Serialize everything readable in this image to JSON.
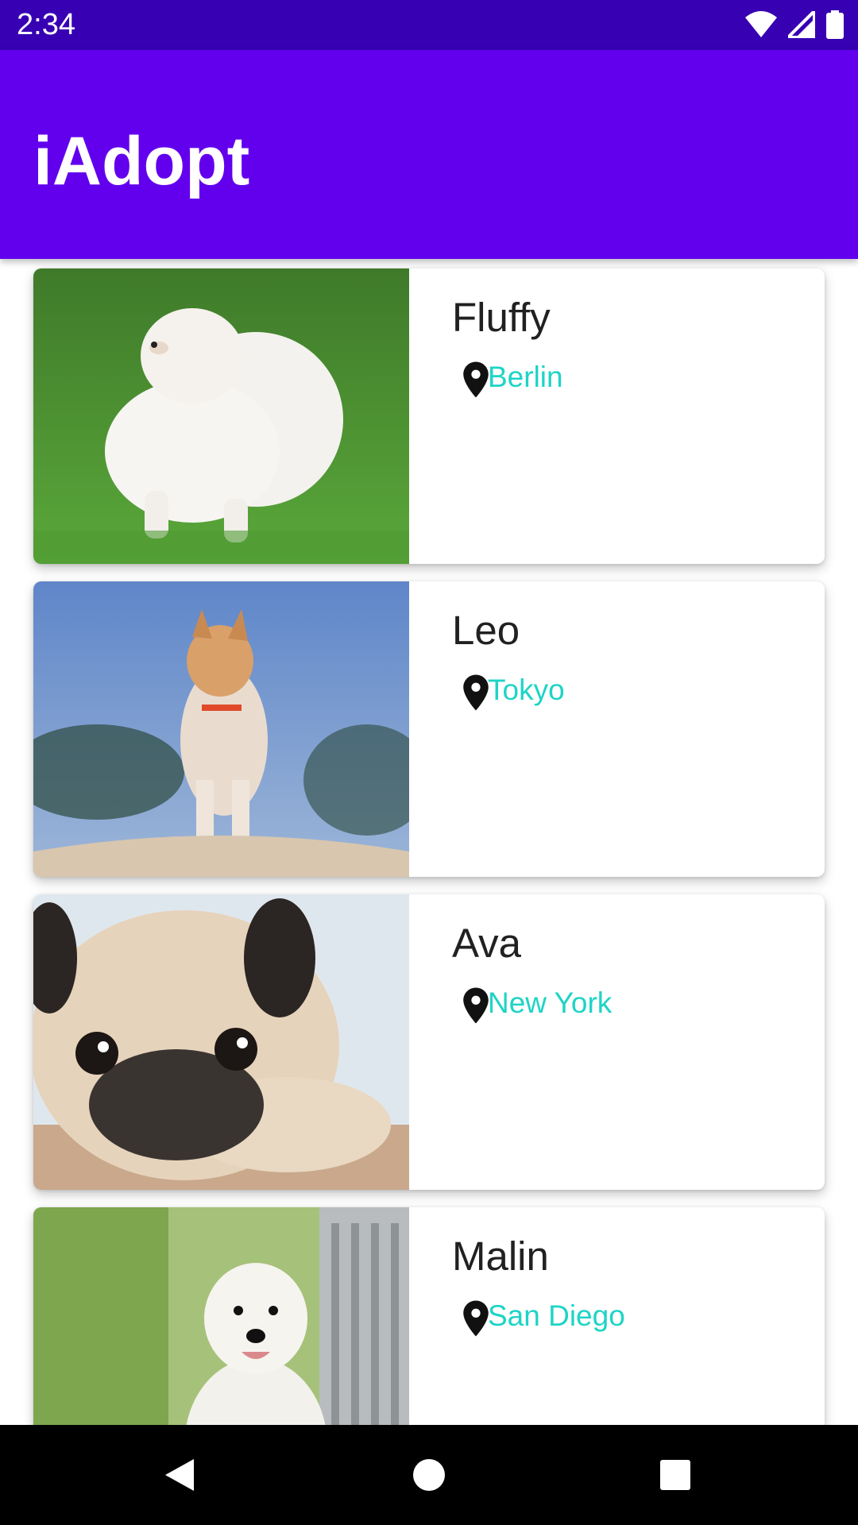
{
  "status_bar": {
    "time": "2:34",
    "icons": [
      "wifi-icon",
      "signal-icon",
      "battery-icon"
    ]
  },
  "app_bar": {
    "title": "iAdopt",
    "color": "#6200ee"
  },
  "pets": [
    {
      "name": "Fluffy",
      "location": "Berlin",
      "photo": "white pomeranian on grass"
    },
    {
      "name": "Leo",
      "location": "Tokyo",
      "photo": "akita dog standing on sand"
    },
    {
      "name": "Ava",
      "location": "New York",
      "photo": "pug lying down"
    },
    {
      "name": "Malin",
      "location": "San Diego",
      "photo": "west highland white terrier sitting"
    }
  ],
  "nav_bar": {
    "buttons": [
      "back-icon",
      "home-icon",
      "recents-icon"
    ]
  },
  "colors": {
    "status_bar": "#3700b3",
    "location_text": "#1ed4c6"
  }
}
